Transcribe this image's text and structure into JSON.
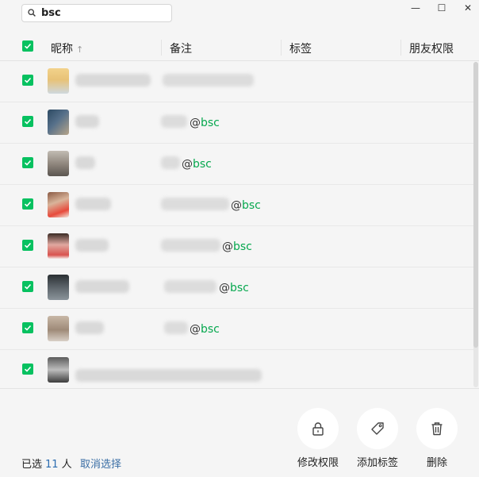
{
  "search": {
    "value": "bsc"
  },
  "window": {
    "minimize": "—",
    "maximize": "☐",
    "close": "✕"
  },
  "columns": {
    "nickname": "昵称",
    "sort_indicator": "↑",
    "remark": "备注",
    "tags": "标签",
    "permission": "朋友权限"
  },
  "rows": [
    {
      "checked": true,
      "remark_suffix_at": "",
      "remark_suffix_tag": ""
    },
    {
      "checked": true,
      "remark_suffix_at": "@",
      "remark_suffix_tag": "bsc"
    },
    {
      "checked": true,
      "remark_suffix_at": "@",
      "remark_suffix_tag": "bsc"
    },
    {
      "checked": true,
      "remark_suffix_at": "@",
      "remark_suffix_tag": "bsc"
    },
    {
      "checked": true,
      "remark_suffix_at": "@",
      "remark_suffix_tag": "bsc"
    },
    {
      "checked": true,
      "remark_suffix_at": "@",
      "remark_suffix_tag": "bsc"
    },
    {
      "checked": true,
      "remark_suffix_at": "@",
      "remark_suffix_tag": "bsc"
    },
    {
      "checked": true,
      "remark_suffix_at": "",
      "remark_suffix_tag": ""
    }
  ],
  "footer": {
    "selected_prefix": "已选",
    "selected_count": "11",
    "selected_unit": "人",
    "deselect": "取消选择",
    "actions": {
      "modify_permission": "修改权限",
      "add_tag": "添加标签",
      "delete": "删除"
    }
  },
  "colors": {
    "accent_green": "#07c160",
    "link_blue": "#3a6ea5"
  }
}
